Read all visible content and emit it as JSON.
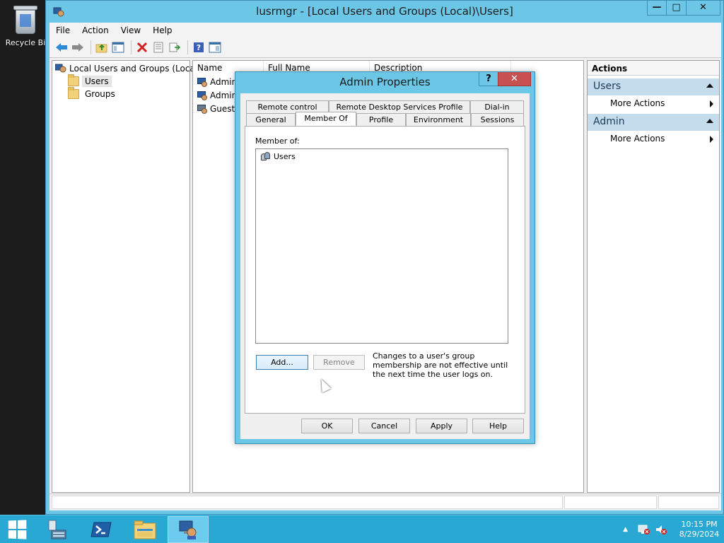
{
  "desktop": {
    "recycle_label": "Recycle Bi"
  },
  "window": {
    "title": "lusrmgr - [Local Users and Groups (Local)\\Users]",
    "min": "—",
    "max": "□",
    "close": "✕"
  },
  "menu": {
    "file": "File",
    "action": "Action",
    "view": "View",
    "help": "Help"
  },
  "tree": {
    "root": "Local Users and Groups (Local)",
    "users": "Users",
    "groups": "Groups"
  },
  "list": {
    "col_name": "Name",
    "col_fullname": "Full Name",
    "col_description": "Description",
    "rows": [
      "Admin",
      "Admin",
      "Guest"
    ]
  },
  "actions": {
    "header": "Actions",
    "section1": "Users",
    "section1_item": "More Actions",
    "section2": "Admin",
    "section2_item": "More Actions"
  },
  "dialog": {
    "title": "Admin Properties",
    "help": "?",
    "close": "✕",
    "tabs_row1": [
      "Remote control",
      "Remote Desktop Services Profile",
      "Dial-in"
    ],
    "tabs_row2": [
      "General",
      "Member Of",
      "Profile",
      "Environment",
      "Sessions"
    ],
    "member_label": "Member of:",
    "member_items": [
      "Users"
    ],
    "add": "Add...",
    "remove": "Remove",
    "note": "Changes to a user's group membership are not effective until the next time the user logs on.",
    "ok": "OK",
    "cancel": "Cancel",
    "apply": "Apply",
    "help_btn": "Help"
  },
  "taskbar": {
    "time": "10:15 PM",
    "date": "8/29/2024",
    "tray_arrow": "▲"
  }
}
